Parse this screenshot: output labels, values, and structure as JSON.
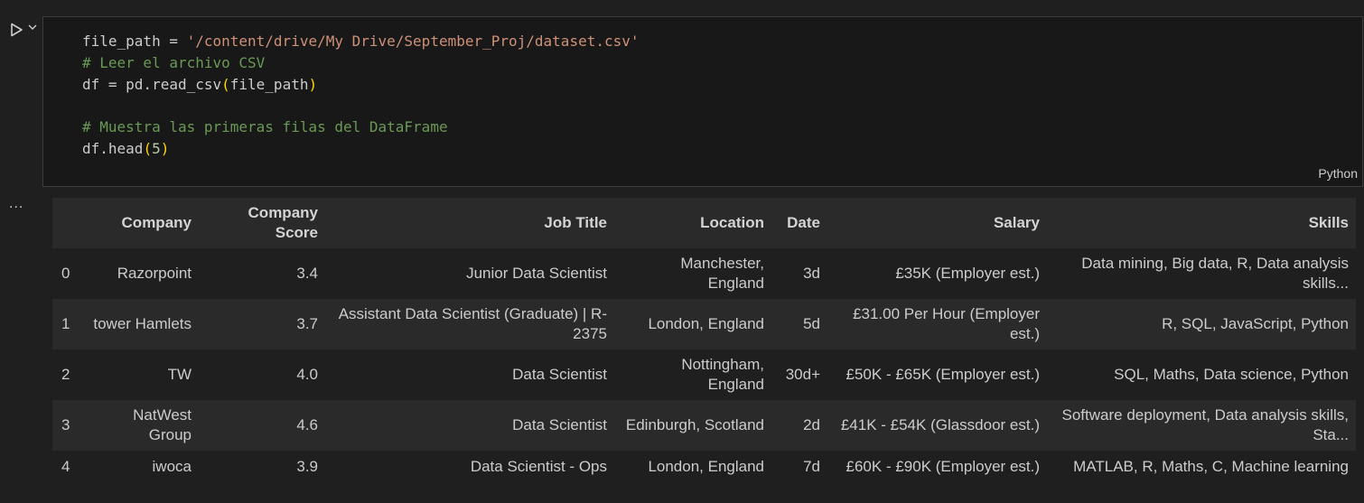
{
  "cell": {
    "code_lines": [
      [
        {
          "t": "file_path = ",
          "c": "var"
        },
        {
          "t": "'/content/drive/My Drive/September_Proj/dataset.csv'",
          "c": "str"
        }
      ],
      [
        {
          "t": "# Leer el archivo CSV",
          "c": "cmt"
        }
      ],
      [
        {
          "t": "df = pd.read_csv",
          "c": "var"
        },
        {
          "t": "(",
          "c": "paren"
        },
        {
          "t": "file_path",
          "c": "var"
        },
        {
          "t": ")",
          "c": "paren"
        }
      ],
      [],
      [
        {
          "t": "# Muestra las primeras filas del DataFrame",
          "c": "cmt"
        }
      ],
      [
        {
          "t": "df.head",
          "c": "var"
        },
        {
          "t": "(",
          "c": "paren"
        },
        {
          "t": "5",
          "c": "num"
        },
        {
          "t": ")",
          "c": "paren"
        }
      ]
    ],
    "language": "Python"
  },
  "output": {
    "menu_label": "...",
    "columns": [
      "",
      "Company",
      "Company Score",
      "Job Title",
      "Location",
      "Date",
      "Salary",
      "Skills"
    ],
    "rows": [
      [
        "0",
        "Razorpoint",
        "3.4",
        "Junior Data Scientist",
        "Manchester, England",
        "3d",
        "£35K (Employer est.)",
        "Data mining, Big data, R, Data analysis skills..."
      ],
      [
        "1",
        "tower Hamlets",
        "3.7",
        "Assistant Data Scientist (Graduate) | R-2375",
        "London, England",
        "5d",
        "£31.00 Per Hour (Employer est.)",
        "R, SQL, JavaScript, Python"
      ],
      [
        "2",
        "TW",
        "4.0",
        "Data Scientist",
        "Nottingham, England",
        "30d+",
        "£50K - £65K (Employer est.)",
        "SQL, Maths, Data science, Python"
      ],
      [
        "3",
        "NatWest Group",
        "4.6",
        "Data Scientist",
        "Edinburgh, Scotland",
        "2d",
        "£41K - £54K (Glassdoor est.)",
        "Software deployment, Data analysis skills, Sta..."
      ],
      [
        "4",
        "iwoca",
        "3.9",
        "Data Scientist - Ops",
        "London, England",
        "7d",
        "£60K - £90K (Employer est.)",
        "MATLAB, R, Maths, C, Machine learning"
      ]
    ]
  }
}
